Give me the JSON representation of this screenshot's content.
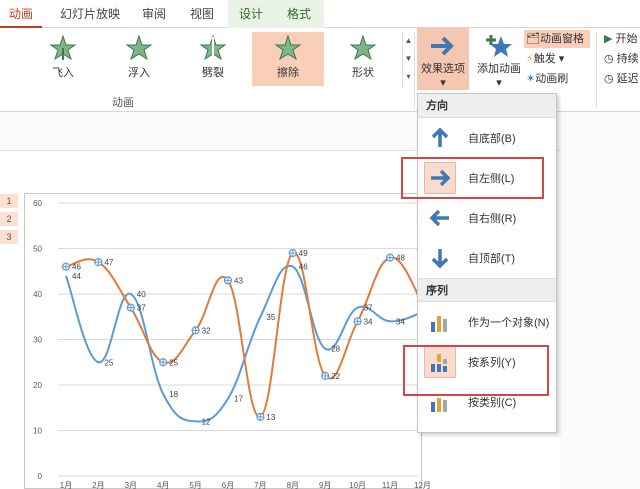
{
  "tabs": [
    {
      "label": "动画",
      "active": true
    },
    {
      "label": "幻灯片放映"
    },
    {
      "label": "审阅"
    },
    {
      "label": "视图"
    },
    {
      "label": "设计",
      "context": true
    },
    {
      "label": "格式",
      "context": true
    }
  ],
  "effects": [
    {
      "label": "飞入",
      "icon": "star-fly-in-icon"
    },
    {
      "label": "浮入",
      "icon": "star-float-in-icon"
    },
    {
      "label": "劈裂",
      "icon": "star-split-icon"
    },
    {
      "label": "擦除",
      "icon": "star-wipe-icon",
      "selected": true
    },
    {
      "label": "形状",
      "icon": "star-shape-icon"
    }
  ],
  "ribbon": {
    "group_label": "动画",
    "effect_options_label": "效果选项",
    "add_animation_label": "添加动画",
    "animation_pane_label": "动画窗格",
    "trigger_label": "触发",
    "animation_painter_label": "动画刷",
    "start_label": "开始",
    "duration_label": "持续",
    "delay_label": "延迟"
  },
  "dropdown": {
    "direction_header": "方向",
    "direction_items": [
      {
        "label": "自底部(B)",
        "icon": "arrow-up-icon"
      },
      {
        "label": "自左侧(L)",
        "icon": "arrow-right-icon",
        "selected": true
      },
      {
        "label": "自右侧(R)",
        "icon": "arrow-left-icon"
      },
      {
        "label": "自顶部(T)",
        "icon": "arrow-down-icon"
      }
    ],
    "sequence_header": "序列",
    "sequence_items": [
      {
        "label": "作为一个对象(N)",
        "icon": "one-object-icon"
      },
      {
        "label": "按系列(Y)",
        "icon": "by-series-icon",
        "selected": true
      },
      {
        "label": "按类别(C)",
        "icon": "by-category-icon"
      }
    ]
  },
  "row_tags": [
    "1",
    "2",
    "3"
  ],
  "colors": {
    "accent": "#c43e1c",
    "orange_series": "#e07b39",
    "blue_series": "#5b9bd5",
    "highlight_box": "#d64545"
  },
  "chart_data": {
    "type": "line",
    "categories": [
      "1月",
      "2月",
      "3月",
      "4月",
      "5月",
      "6月",
      "7月",
      "8月",
      "9月",
      "10月",
      "11月",
      "12月"
    ],
    "series": [
      {
        "color": "#5b9bd5",
        "values": [
          44,
          25,
          40,
          18,
          12,
          17,
          35,
          46,
          28,
          37,
          34,
          36
        ]
      },
      {
        "color": "#e07b39",
        "values": [
          46,
          47,
          37,
          25,
          32,
          43,
          13,
          49,
          22,
          34,
          48,
          38
        ]
      }
    ],
    "labels_shown": [
      {
        "series": 0,
        "values": [
          44,
          25,
          40,
          18,
          12,
          17,
          35,
          46,
          28,
          37,
          34
        ]
      },
      {
        "series": 1,
        "values": [
          46,
          47,
          37,
          25,
          32,
          43,
          13,
          49,
          22,
          34,
          48
        ]
      }
    ],
    "ylim": [
      0,
      60
    ],
    "yticks": [
      0,
      10,
      20,
      30,
      40,
      50,
      60
    ],
    "grid": true
  }
}
